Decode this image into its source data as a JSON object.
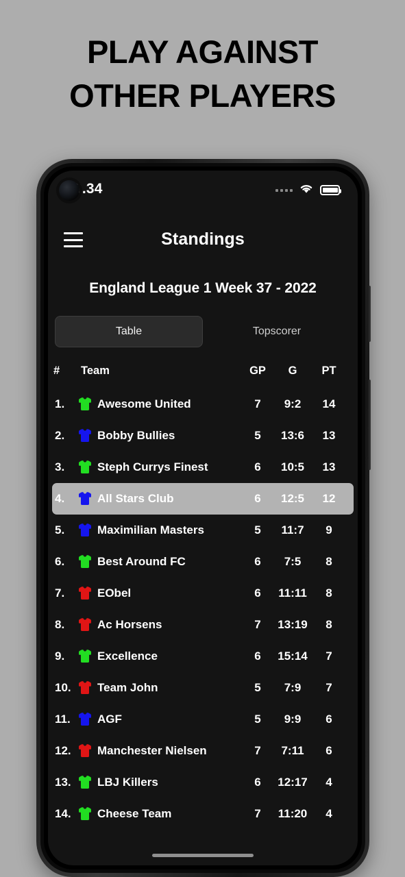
{
  "promo": {
    "headline_line1": "PLAY AGAINST",
    "headline_line2": "OTHER PLAYERS"
  },
  "statusbar": {
    "time": "0.34",
    "wifi_icon": "wifi-icon",
    "battery_icon": "battery-icon",
    "signal_icon": "signal-dots-icon"
  },
  "appbar": {
    "menu_icon": "hamburger-menu-icon",
    "title": "Standings"
  },
  "league": {
    "subtitle": "England League 1 Week 37 - 2022"
  },
  "tabs": [
    {
      "label": "Table",
      "selected": true
    },
    {
      "label": "Topscorer",
      "selected": false
    }
  ],
  "table": {
    "headers": {
      "rank": "#",
      "team": "Team",
      "gp": "GP",
      "g": "G",
      "pt": "PT"
    },
    "rows": [
      {
        "rank": "1.",
        "jersey": "green",
        "team": "Awesome United",
        "gp": "7",
        "g": "9:2",
        "pt": "14",
        "highlighted": false
      },
      {
        "rank": "2.",
        "jersey": "blue",
        "team": "Bobby Bullies",
        "gp": "5",
        "g": "13:6",
        "pt": "13",
        "highlighted": false
      },
      {
        "rank": "3.",
        "jersey": "green",
        "team": "Steph Currys Finest",
        "gp": "6",
        "g": "10:5",
        "pt": "13",
        "highlighted": false
      },
      {
        "rank": "4.",
        "jersey": "blue",
        "team": "All Stars Club",
        "gp": "6",
        "g": "12:5",
        "pt": "12",
        "highlighted": true
      },
      {
        "rank": "5.",
        "jersey": "blue",
        "team": "Maximilian Masters",
        "gp": "5",
        "g": "11:7",
        "pt": "9",
        "highlighted": false
      },
      {
        "rank": "6.",
        "jersey": "green",
        "team": "Best Around FC",
        "gp": "6",
        "g": "7:5",
        "pt": "8",
        "highlighted": false
      },
      {
        "rank": "7.",
        "jersey": "red",
        "team": "EObel",
        "gp": "6",
        "g": "11:11",
        "pt": "8",
        "highlighted": false
      },
      {
        "rank": "8.",
        "jersey": "red",
        "team": "Ac Horsens",
        "gp": "7",
        "g": "13:19",
        "pt": "8",
        "highlighted": false
      },
      {
        "rank": "9.",
        "jersey": "green",
        "team": "Excellence",
        "gp": "6",
        "g": "15:14",
        "pt": "7",
        "highlighted": false
      },
      {
        "rank": "10.",
        "jersey": "red",
        "team": "Team John",
        "gp": "5",
        "g": "7:9",
        "pt": "7",
        "highlighted": false
      },
      {
        "rank": "11.",
        "jersey": "blue",
        "team": "AGF",
        "gp": "5",
        "g": "9:9",
        "pt": "6",
        "highlighted": false
      },
      {
        "rank": "12.",
        "jersey": "red",
        "team": "Manchester Nielsen",
        "gp": "7",
        "g": "7:11",
        "pt": "6",
        "highlighted": false
      },
      {
        "rank": "13.",
        "jersey": "green",
        "team": "LBJ Killers",
        "gp": "6",
        "g": "12:17",
        "pt": "4",
        "highlighted": false
      },
      {
        "rank": "14.",
        "jersey": "green",
        "team": "Cheese Team",
        "gp": "7",
        "g": "11:20",
        "pt": "4",
        "highlighted": false
      }
    ]
  },
  "colors": {
    "page_background": "#adadad",
    "screen_background": "#141414",
    "highlight_row": "#b3b3b3",
    "tab_selected_background": "#2b2b2b",
    "jersey_green": "#22dd22",
    "jersey_blue": "#1515ee",
    "jersey_red": "#e01515",
    "text_primary": "#ffffff"
  },
  "navigation": {
    "home_indicator": "home-indicator"
  }
}
